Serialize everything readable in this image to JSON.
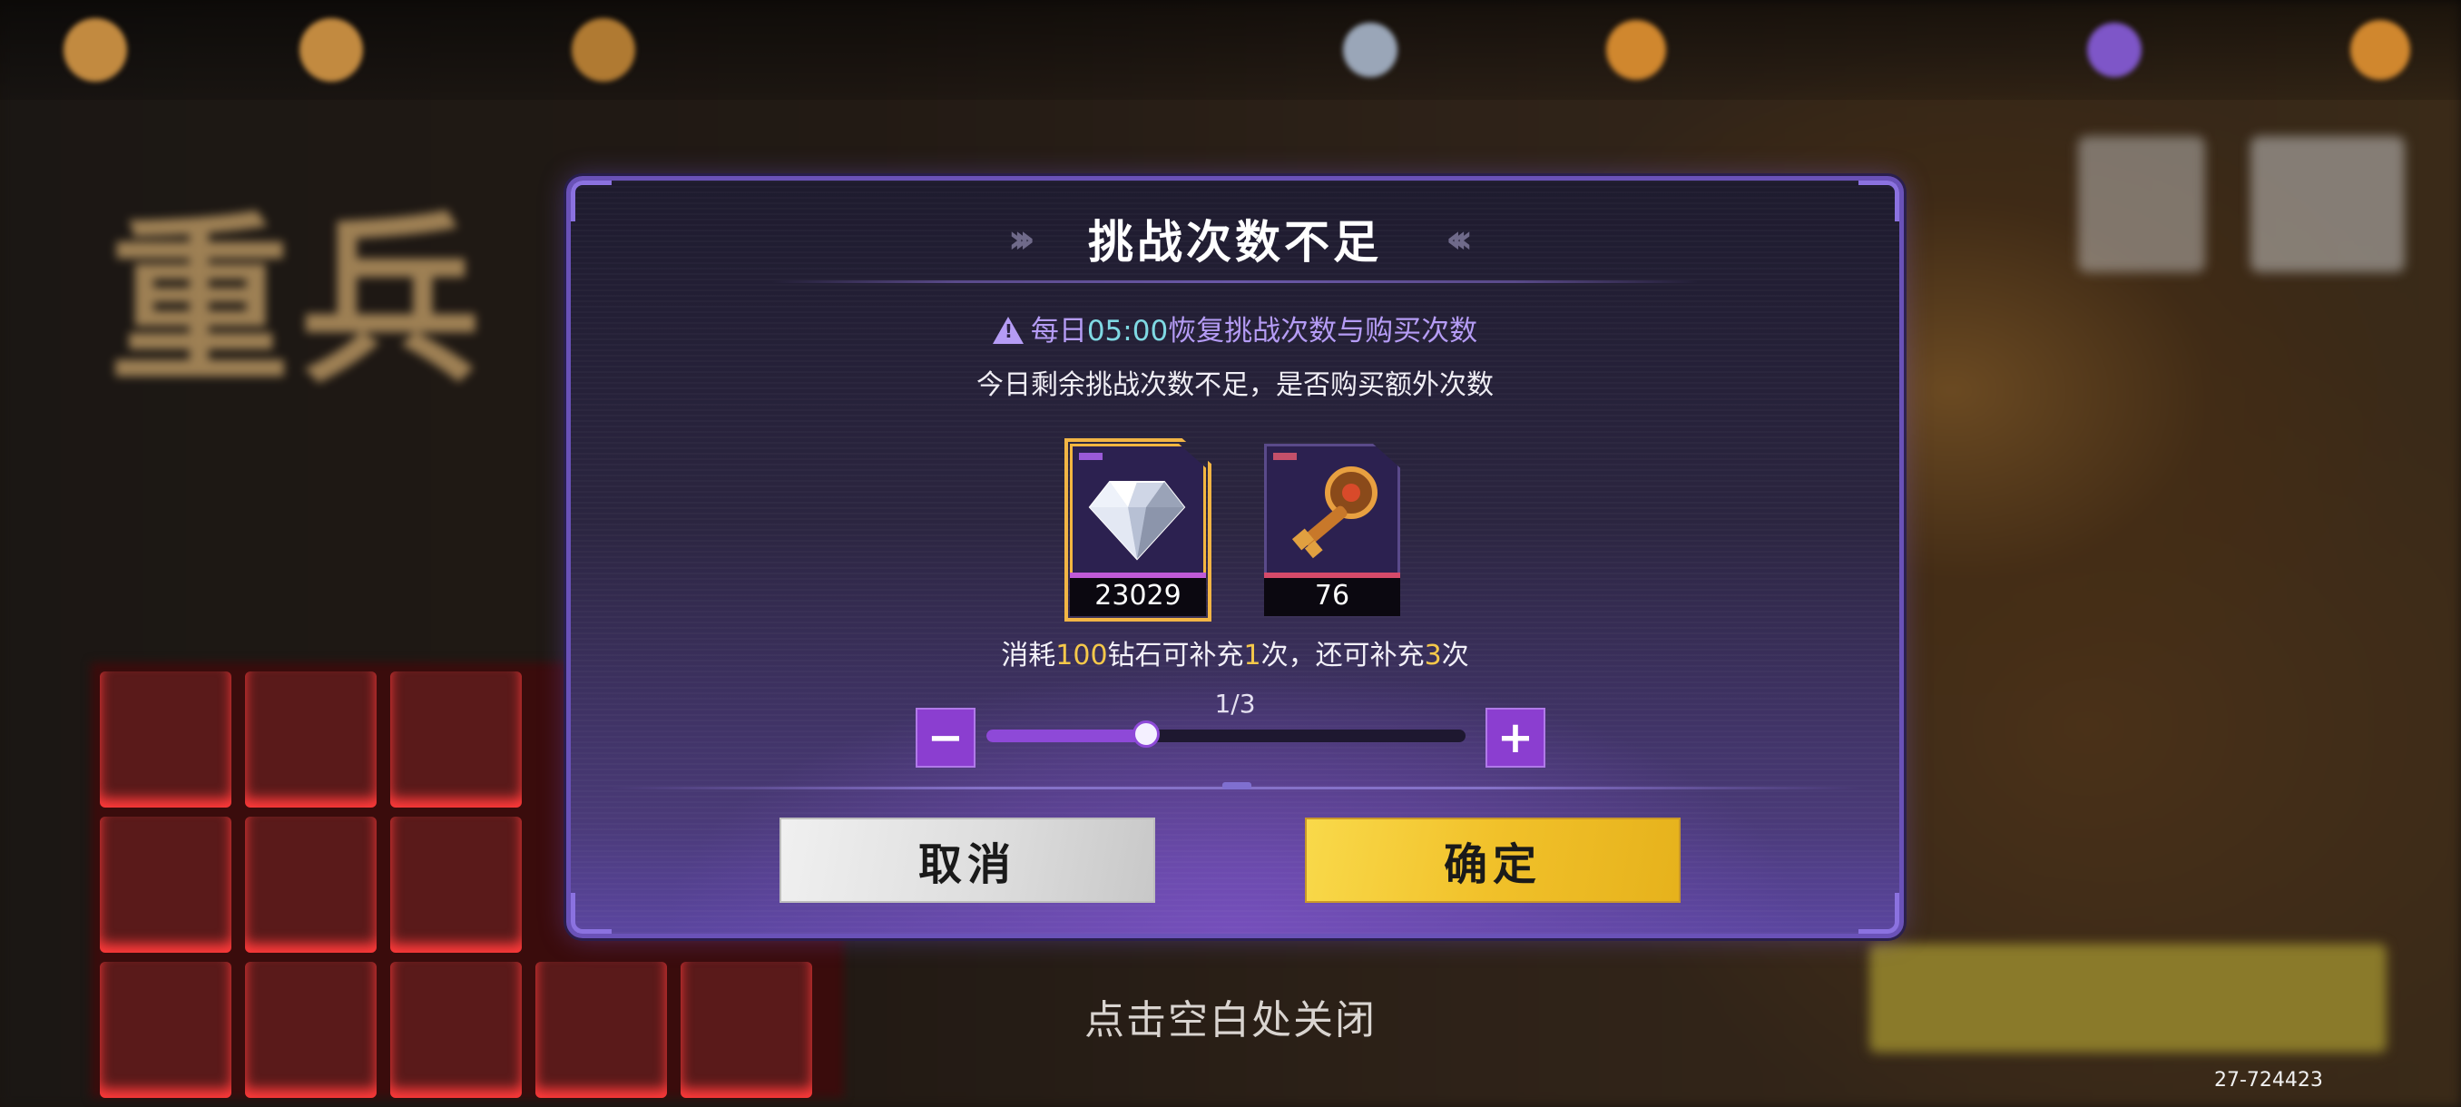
{
  "dialog": {
    "title": "挑战次数不足",
    "notice_prefix": "每日",
    "notice_time": "05:00",
    "notice_suffix": "恢复挑战次数与购买次数",
    "subtitle": "今日剩余挑战次数不足，是否购买额外次数",
    "items": [
      {
        "name": "diamond",
        "count": "23029",
        "selected": true
      },
      {
        "name": "key",
        "count": "76",
        "selected": false
      }
    ],
    "consume": {
      "part1": "消耗",
      "cost": "100",
      "part2": "钻石可补充",
      "gain": "1",
      "part3": "次，还可补充",
      "remaining": "3",
      "part4": "次"
    },
    "stepper": {
      "ratio_text": "1/3",
      "value": 1,
      "max": 3
    },
    "cancel_label": "取消",
    "confirm_label": "确定"
  },
  "close_hint": "点击空白处关闭",
  "uid": "27-724423",
  "colors": {
    "accent_purple": "#8e49d8",
    "highlight_gold": "#f5c84a",
    "notice_cyan": "#7fd9e3"
  }
}
